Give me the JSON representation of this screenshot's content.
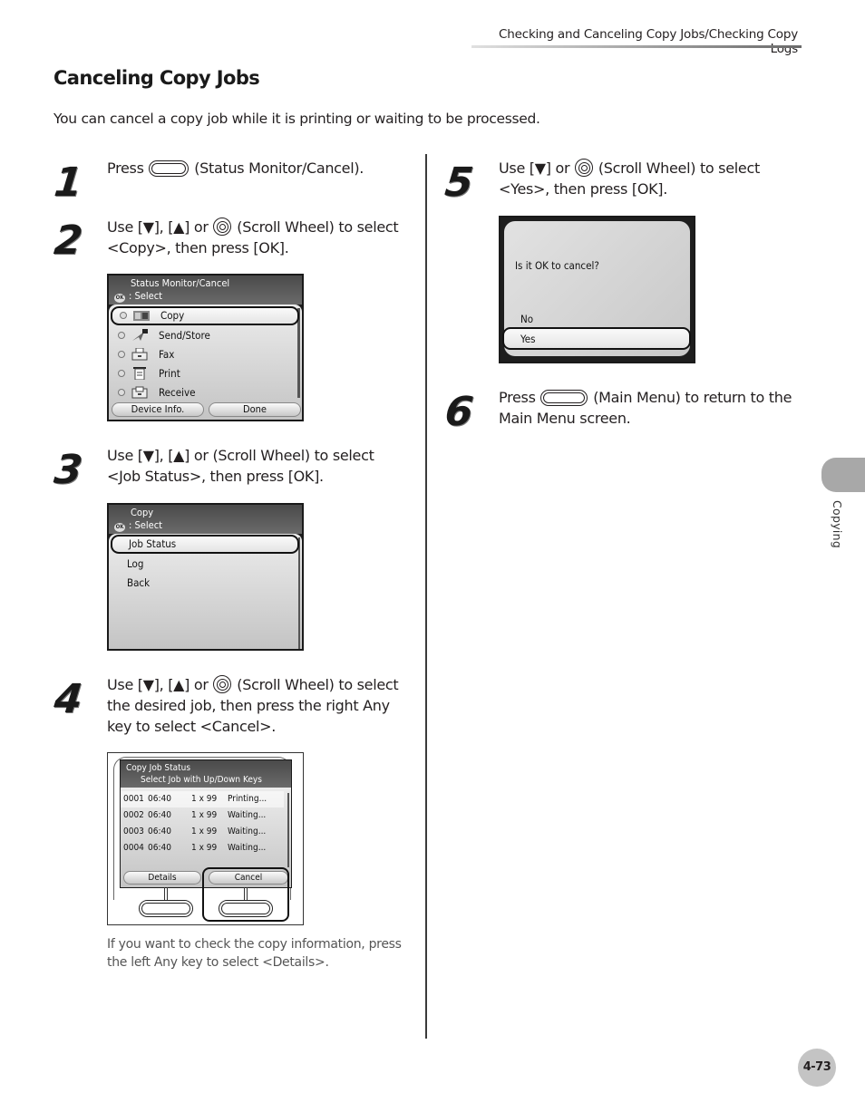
{
  "running_header": "Checking and Canceling Copy Jobs/Checking Copy Logs",
  "section_title": "Canceling Copy Jobs",
  "intro": "You can cancel a copy job while it is printing or waiting to be processed.",
  "steps": [
    {
      "number": "1",
      "parts": [
        "Press",
        "key-icon",
        "(Status Monitor/Cancel)."
      ]
    },
    {
      "number": "2",
      "line1_a": "Use [▼], [▲] or",
      "line1_b": "(Scroll Wheel) to select",
      "line2": "<Copy>, then press [OK].",
      "screen": {
        "title": "Status Monitor/Cancel",
        "subtitle": ": Select",
        "ok_glyph": "OK",
        "items": [
          {
            "icon": "copy-icon",
            "label": "Copy",
            "selected": true
          },
          {
            "icon": "send-store-icon",
            "label": "Send/Store",
            "selected": false
          },
          {
            "icon": "fax-icon",
            "label": "Fax",
            "selected": false
          },
          {
            "icon": "print-icon",
            "label": "Print",
            "selected": false
          },
          {
            "icon": "receive-icon",
            "label": "Receive",
            "selected": false
          }
        ],
        "buttons": [
          "Device Info.",
          "Done"
        ]
      }
    },
    {
      "number": "3",
      "line1": "Use [▼], [▲] or (Scroll Wheel) to select",
      "line2": "<Job Status>, then press [OK].",
      "screen": {
        "title": "Copy",
        "subtitle": ": Select",
        "ok_glyph": "OK",
        "items": [
          {
            "label": "Job Status",
            "selected": true
          },
          {
            "label": "Log",
            "selected": false
          },
          {
            "label": "Back",
            "selected": false
          }
        ]
      }
    },
    {
      "number": "4",
      "line1_a": "Use [▼], [▲] or",
      "line1_b": "(Scroll Wheel) to select",
      "line2": "the desired job, then press the right Any",
      "line3": "key to select <Cancel>.",
      "screen": {
        "title": "Copy Job Status",
        "subtitle": "Select Job with Up/Down Keys",
        "jobs": [
          {
            "id": "0001",
            "time": "06:40",
            "qty": "1 x 99",
            "status": "Printing..."
          },
          {
            "id": "0002",
            "time": "06:40",
            "qty": "1 x 99",
            "status": "Waiting..."
          },
          {
            "id": "0003",
            "time": "06:40",
            "qty": "1 x 99",
            "status": "Waiting..."
          },
          {
            "id": "0004",
            "time": "06:40",
            "qty": "1 x 99",
            "status": "Waiting..."
          }
        ],
        "buttons": [
          "Details",
          "Cancel"
        ]
      },
      "note_line1": "If you want to check the copy information, press",
      "note_line2": "the left Any key to select <Details>."
    },
    {
      "number": "5",
      "line1_a": "Use [▼] or",
      "line1_b": "(Scroll Wheel) to select",
      "line2": "<Yes>, then press [OK].",
      "screen": {
        "question": "Is it OK to cancel?",
        "options": [
          {
            "label": "No",
            "selected": false
          },
          {
            "label": "Yes",
            "selected": true
          }
        ]
      }
    },
    {
      "number": "6",
      "line1_a": "Press",
      "line1_b": "(Main Menu) to return to the",
      "line2": "Main Menu screen."
    }
  ],
  "side_tab_label": "Copying",
  "page_number": "4-73"
}
